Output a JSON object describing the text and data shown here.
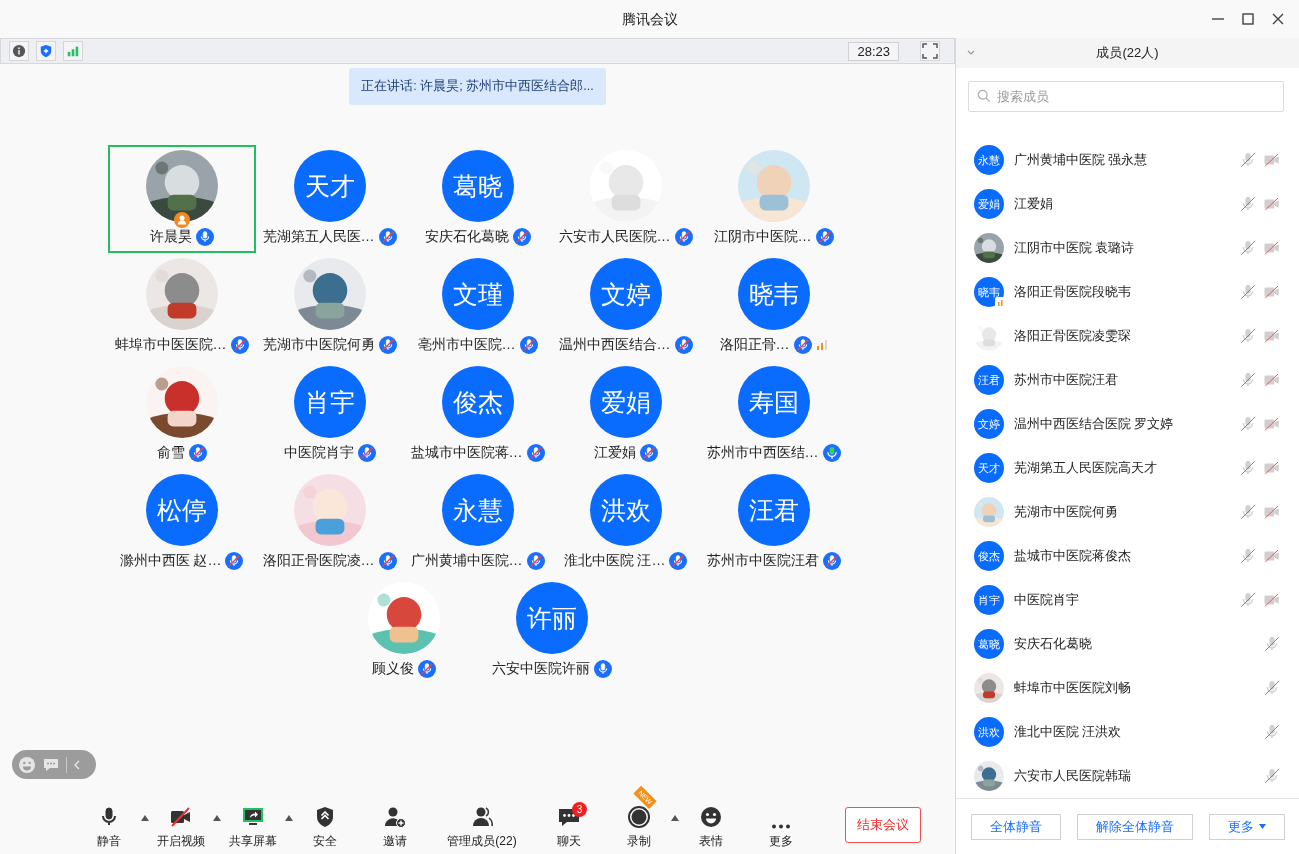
{
  "window": {
    "title": "腾讯会议"
  },
  "info_bar": {
    "timer": "28:23"
  },
  "speaking_banner": "正在讲话: 许晨昊; 苏州市中西医结合郎...",
  "tiles": [
    {
      "name": "许晨昊",
      "muted": false,
      "speaking": false,
      "selected": true,
      "host": true,
      "weak_network": false
    },
    {
      "name": "芜湖第五人民医…",
      "avatar": {
        "kind": "initials",
        "text": "天才"
      },
      "muted": true,
      "speaking": false,
      "selected": false,
      "host": false,
      "weak_network": false
    },
    {
      "name": "安庆石化葛晓",
      "avatar": {
        "kind": "initials",
        "text": "葛晓"
      },
      "muted": true,
      "speaking": false,
      "selected": false,
      "host": false,
      "weak_network": false
    },
    {
      "name": "六安市人民医院…",
      "muted": true,
      "speaking": false,
      "selected": false,
      "host": false,
      "weak_network": false
    },
    {
      "name": "江阴市中医院…",
      "muted": true,
      "speaking": false,
      "selected": false,
      "host": false,
      "weak_network": false
    },
    {
      "name": "蚌埠市中医医院…",
      "muted": true,
      "speaking": false,
      "selected": false,
      "host": false,
      "weak_network": false
    },
    {
      "name": "芜湖市中医院何勇",
      "muted": true,
      "speaking": false,
      "selected": false,
      "host": false,
      "weak_network": false
    },
    {
      "name": "亳州市中医院…",
      "avatar": {
        "kind": "initials",
        "text": "文瑾"
      },
      "muted": true,
      "speaking": false,
      "selected": false,
      "host": false,
      "weak_network": false
    },
    {
      "name": "温州中西医结合…",
      "avatar": {
        "kind": "initials",
        "text": "文婷"
      },
      "muted": true,
      "speaking": false,
      "selected": false,
      "host": false,
      "weak_network": false
    },
    {
      "name": "洛阳正骨…",
      "avatar": {
        "kind": "initials",
        "text": "晓韦"
      },
      "muted": true,
      "speaking": false,
      "selected": false,
      "host": false,
      "weak_network": true
    },
    {
      "name": "俞雪",
      "muted": true,
      "speaking": false,
      "selected": false,
      "host": false,
      "weak_network": false
    },
    {
      "name": "中医院肖宇",
      "avatar": {
        "kind": "initials",
        "text": "肖宇"
      },
      "muted": true,
      "speaking": false,
      "selected": false,
      "host": false,
      "weak_network": false
    },
    {
      "name": "盐城市中医院蒋…",
      "avatar": {
        "kind": "initials",
        "text": "俊杰"
      },
      "muted": true,
      "speaking": false,
      "selected": false,
      "host": false,
      "weak_network": false
    },
    {
      "name": "江爱娟",
      "avatar": {
        "kind": "initials",
        "text": "爱娟"
      },
      "muted": true,
      "speaking": false,
      "selected": false,
      "host": false,
      "weak_network": false
    },
    {
      "name": "苏州市中西医结…",
      "avatar": {
        "kind": "initials",
        "text": "寿国"
      },
      "muted": false,
      "speaking": true,
      "selected": false,
      "host": false,
      "weak_network": false
    },
    {
      "name": "滁州中西医  赵…",
      "avatar": {
        "kind": "initials",
        "text": "松停"
      },
      "muted": true,
      "speaking": false,
      "selected": false,
      "host": false,
      "weak_network": false
    },
    {
      "name": "洛阳正骨医院凌…",
      "muted": true,
      "speaking": false,
      "selected": false,
      "host": false,
      "weak_network": false
    },
    {
      "name": "广州黄埔中医院…",
      "avatar": {
        "kind": "initials",
        "text": "永慧"
      },
      "muted": true,
      "speaking": false,
      "selected": false,
      "host": false,
      "weak_network": false
    },
    {
      "name": "淮北中医院 汪…",
      "avatar": {
        "kind": "initials",
        "text": "洪欢"
      },
      "muted": true,
      "speaking": false,
      "selected": false,
      "host": false,
      "weak_network": false
    },
    {
      "name": "苏州市中医院汪君",
      "avatar": {
        "kind": "initials",
        "text": "汪君"
      },
      "muted": true,
      "speaking": false,
      "selected": false,
      "host": false,
      "weak_network": false
    },
    {
      "name": "顾义俊",
      "muted": true,
      "speaking": false,
      "selected": false,
      "host": false,
      "weak_network": false
    },
    {
      "name": "六安中医院许丽",
      "avatar": {
        "kind": "initials",
        "text": "许丽"
      },
      "muted": false,
      "speaking": false,
      "selected": false,
      "host": false,
      "weak_network": false
    }
  ],
  "toolbar": {
    "items": [
      {
        "label": "静音",
        "kind": "mic",
        "caret": true
      },
      {
        "label": "开启视频",
        "kind": "video_off",
        "caret": true
      },
      {
        "label": "共享屏幕",
        "kind": "share",
        "caret": true
      },
      {
        "label": "安全",
        "kind": "shield",
        "caret": false
      },
      {
        "label": "邀请",
        "kind": "invite",
        "caret": false
      },
      {
        "label": "管理成员(22)",
        "kind": "members",
        "caret": false
      },
      {
        "label": "聊天",
        "kind": "chat",
        "caret": false,
        "badge": "3"
      },
      {
        "label": "录制",
        "kind": "record",
        "caret": true,
        "ribbon": "NEW"
      },
      {
        "label": "表情",
        "kind": "emoji",
        "caret": false
      },
      {
        "label": "更多",
        "kind": "more",
        "caret": false
      }
    ],
    "end_button": "结束会议"
  },
  "members_panel": {
    "title": "成员(22人)",
    "search": {
      "placeholder": "搜索成员"
    },
    "members": [
      {
        "name": "广州黄埔中医院 强永慧",
        "avatar": {
          "kind": "initials",
          "text": "永慧"
        },
        "mic_muted": true,
        "video_icon": true,
        "weak_network": false
      },
      {
        "name": "江爱娟",
        "avatar": {
          "kind": "initials",
          "text": "爱娟"
        },
        "mic_muted": true,
        "video_icon": true,
        "weak_network": false
      },
      {
        "name": "江阴市中医院 袁璐诗",
        "mic_muted": true,
        "video_icon": true,
        "weak_network": false
      },
      {
        "name": "洛阳正骨医院段晓韦",
        "avatar": {
          "kind": "initials",
          "text": "晓韦"
        },
        "mic_muted": true,
        "video_icon": true,
        "weak_network": true
      },
      {
        "name": "洛阳正骨医院凌雯琛",
        "mic_muted": true,
        "video_icon": true,
        "weak_network": false
      },
      {
        "name": "苏州市中医院汪君",
        "avatar": {
          "kind": "initials",
          "text": "汪君"
        },
        "mic_muted": true,
        "video_icon": true,
        "weak_network": false
      },
      {
        "name": "温州中西医结合医院 罗文婷",
        "avatar": {
          "kind": "initials",
          "text": "文婷"
        },
        "mic_muted": true,
        "video_icon": true,
        "weak_network": false
      },
      {
        "name": "芜湖第五人民医院高天才",
        "avatar": {
          "kind": "initials",
          "text": "天才"
        },
        "mic_muted": true,
        "video_icon": true,
        "weak_network": false
      },
      {
        "name": "芜湖市中医院何勇",
        "mic_muted": true,
        "video_icon": true,
        "weak_network": false
      },
      {
        "name": "盐城市中医院蒋俊杰",
        "avatar": {
          "kind": "initials",
          "text": "俊杰"
        },
        "mic_muted": true,
        "video_icon": true,
        "weak_network": false
      },
      {
        "name": "中医院肖宇",
        "avatar": {
          "kind": "initials",
          "text": "肖宇"
        },
        "mic_muted": true,
        "video_icon": true,
        "weak_network": false
      },
      {
        "name": "安庆石化葛晓",
        "avatar": {
          "kind": "initials",
          "text": "葛晓"
        },
        "mic_muted": true,
        "video_icon": false,
        "weak_network": false
      },
      {
        "name": "蚌埠市中医医院刘畅",
        "mic_muted": true,
        "video_icon": false,
        "weak_network": false
      },
      {
        "name": "淮北中医院 汪洪欢",
        "avatar": {
          "kind": "initials",
          "text": "洪欢"
        },
        "mic_muted": true,
        "video_icon": false,
        "weak_network": false
      },
      {
        "name": "六安市人民医院韩瑞",
        "mic_muted": true,
        "video_icon": false,
        "weak_network": false
      }
    ],
    "buttons": [
      {
        "label": "全体静音",
        "caret": false
      },
      {
        "label": "解除全体静音",
        "caret": false
      },
      {
        "label": "更多",
        "caret": true
      }
    ]
  }
}
